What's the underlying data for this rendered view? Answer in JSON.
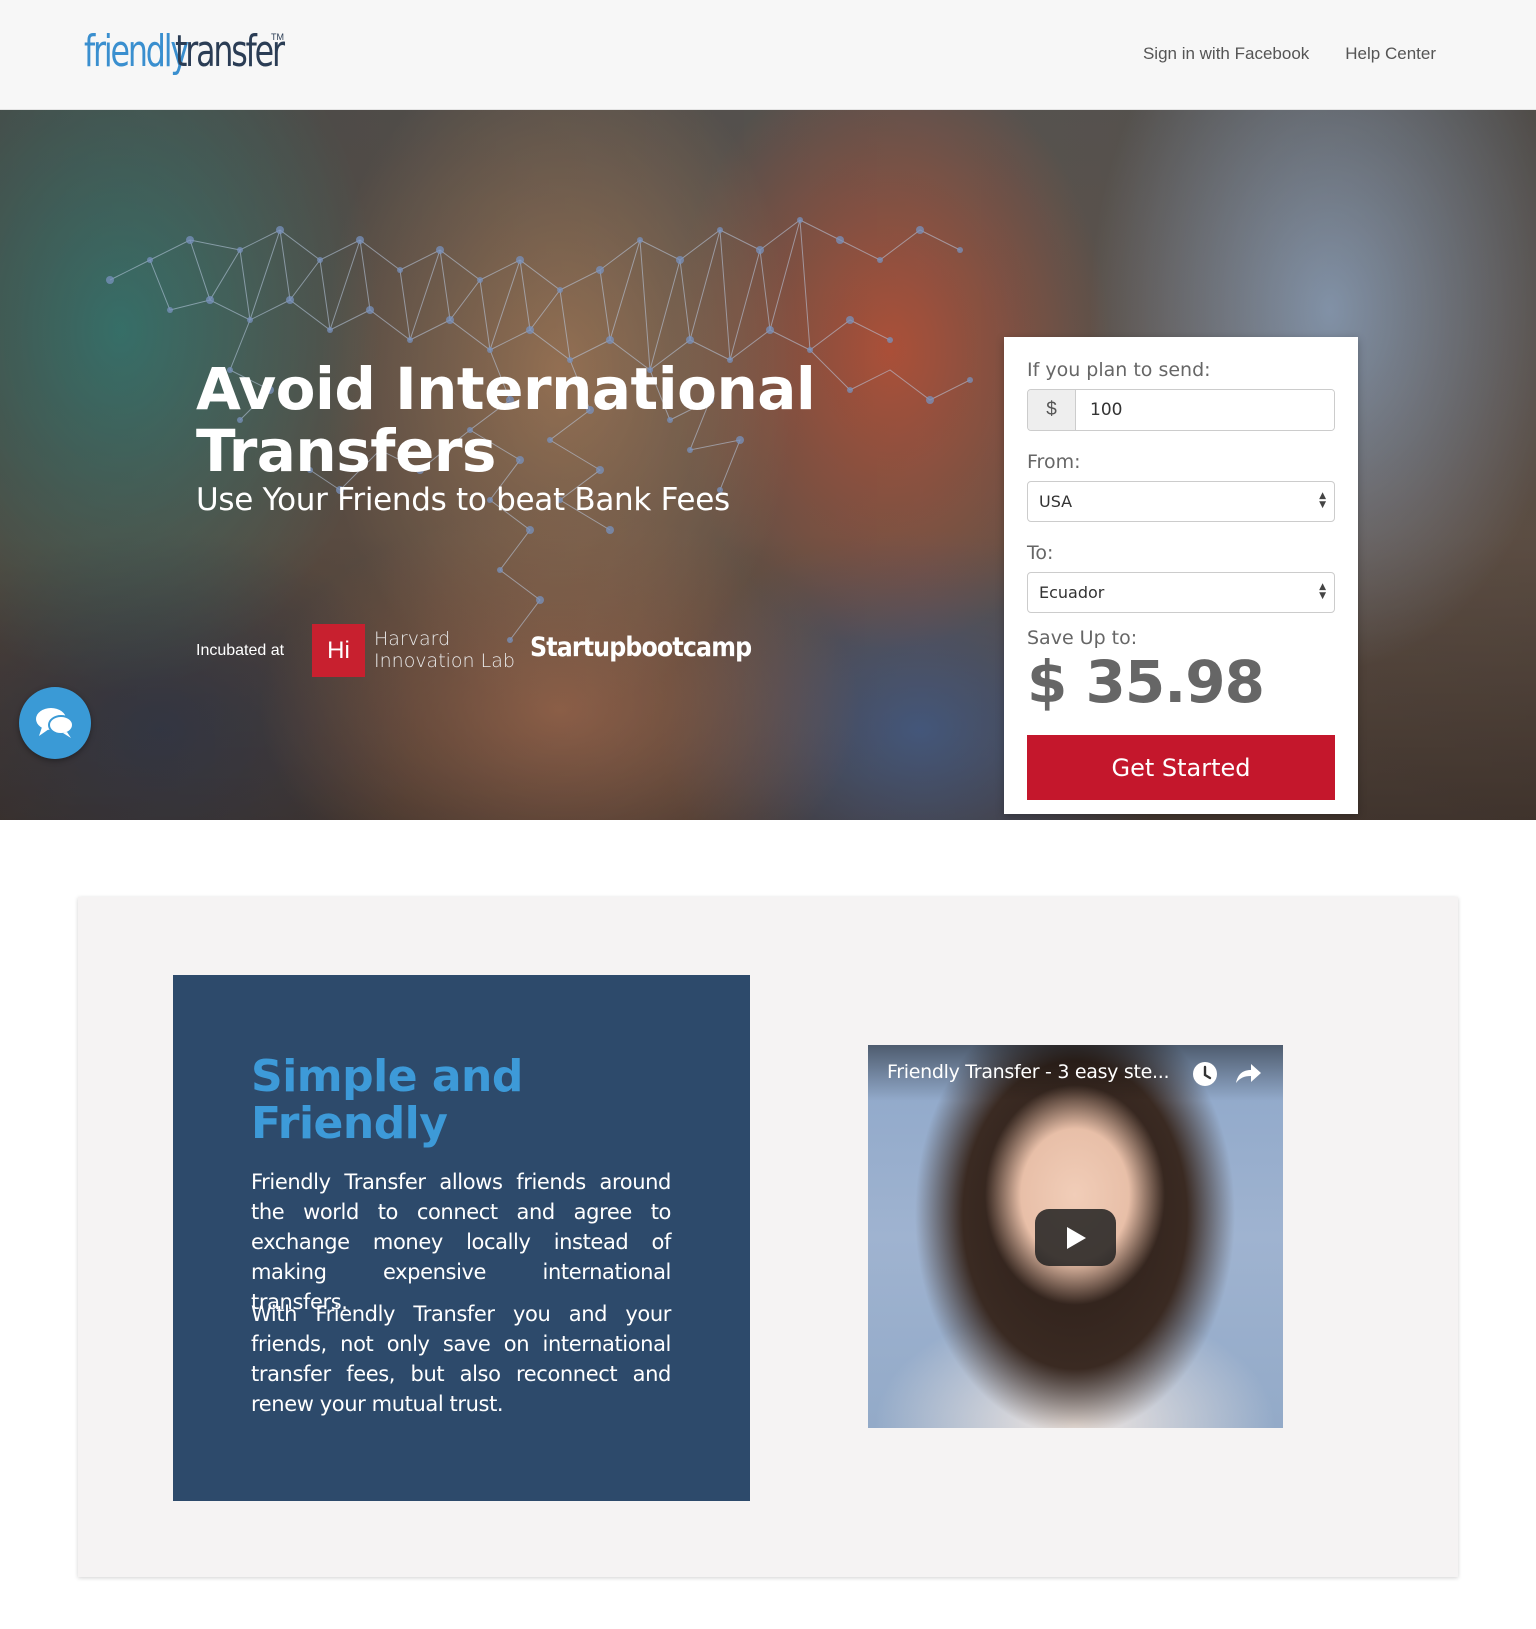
{
  "header": {
    "logo_primary": "friendly",
    "logo_secondary": "transfer",
    "logo_tm": "TM",
    "nav": [
      {
        "label": "Sign in with Facebook"
      },
      {
        "label": "Help Center"
      }
    ]
  },
  "hero": {
    "title": "Avoid International Transfers",
    "subtitle": "Use Your Friends to beat Bank Fees",
    "incubated_label": "Incubated at",
    "partner_hi": "Hi",
    "partner_harvard_line1": "Harvard",
    "partner_harvard_line2": "Innovation Lab",
    "partner_startup": "Startupbootcamp"
  },
  "calculator": {
    "send_label": "If you plan to send:",
    "currency_symbol": "$",
    "amount": "100",
    "from_label": "From:",
    "from_value": "USA",
    "to_label": "To:",
    "to_value": "Ecuador",
    "save_label": "Save Up to:",
    "save_amount": "$ 35.98",
    "cta_label": "Get Started"
  },
  "info": {
    "title_line1": "Simple and",
    "title_line2": "Friendly",
    "paragraph1": "Friendly Transfer allows friends around the world to connect and agree to exchange money locally instead of making expensive international transfers.",
    "paragraph2": "With Friendly Transfer you and your friends, not only save on international transfer fees, but also reconnect and renew your mutual trust."
  },
  "video": {
    "title": "Friendly Transfer - 3 easy ste..."
  },
  "icons": {
    "chat": "chat-bubble-icon",
    "watch_later": "clock-icon",
    "share": "share-arrow-icon",
    "play": "play-icon"
  },
  "colors": {
    "brand_blue": "#3a8fcf",
    "brand_navy": "#2b3d55",
    "cta_red": "#c4172c",
    "info_box": "#2d4a6b",
    "info_title": "#3d9ad8",
    "harvard_red": "#c8202f"
  }
}
